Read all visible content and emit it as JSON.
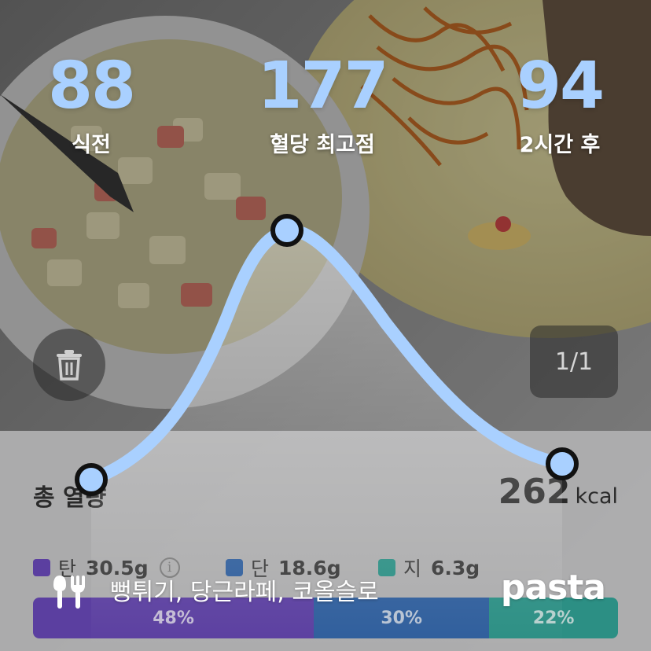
{
  "stats": {
    "before": {
      "value": "88",
      "label": "식전"
    },
    "peak": {
      "value": "177",
      "label": "혈당 최고점"
    },
    "after": {
      "value": "94",
      "label": "2시간 후"
    }
  },
  "photo_pager": "1/1",
  "summary": {
    "total_label": "총 열량",
    "kcal_value": "262",
    "kcal_unit": "kcal"
  },
  "macros": [
    {
      "key": "탄",
      "value": "30.5g",
      "color": "#5b3fa0",
      "percent": "48%",
      "fraction": 0.48
    },
    {
      "key": "단",
      "value": "18.6g",
      "color": "#2f5e9c",
      "percent": "30%",
      "fraction": 0.3
    },
    {
      "key": "지",
      "value": "6.3g",
      "color": "#2c8f84",
      "percent": "22%",
      "fraction": 0.22
    }
  ],
  "meal": {
    "icon": "fork-knife-icon",
    "foods": "뻥튀기, 당근라페, 코올슬로"
  },
  "brand": "pasta",
  "colors": {
    "accent": "#a9d0ff",
    "curve": "#a9d0ff"
  }
}
